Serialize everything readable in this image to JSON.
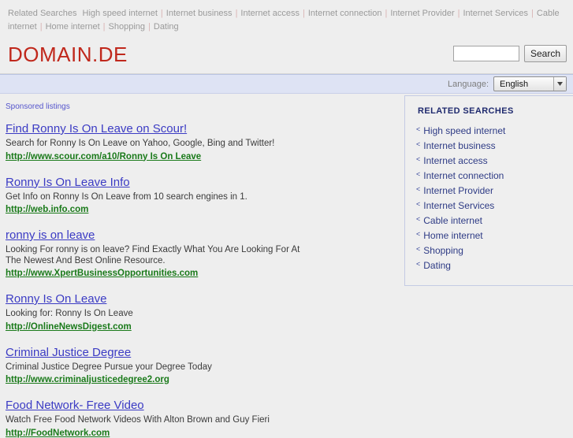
{
  "top_strip": {
    "label": "Related Searches",
    "links": [
      "High speed internet",
      "Internet business",
      "Internet access",
      "Internet connection",
      "Internet Provider",
      "Internet Services",
      "Cable internet",
      "Home internet",
      "Shopping",
      "Dating"
    ]
  },
  "header": {
    "logo": "DOMAIN.DE",
    "search_value": "",
    "search_placeholder": "",
    "search_button": "Search"
  },
  "language_bar": {
    "label": "Language:",
    "selected": "English",
    "arrow_icon": "chevron-down-icon"
  },
  "main": {
    "sponsored_label": "Sponsored listings",
    "ads": [
      {
        "title": "Find Ronny Is On Leave on Scour!",
        "desc": "Search for Ronny Is On Leave on Yahoo, Google, Bing and Twitter!",
        "url": "http://www.scour.com/a10/Ronny Is On Leave"
      },
      {
        "title": "Ronny Is On Leave Info",
        "desc": "Get Info on Ronny Is On Leave from 10 search engines in 1.",
        "url": "http://web.info.com"
      },
      {
        "title": "ronny is on leave",
        "desc": "Looking For ronny is on leave? Find Exactly What You Are Looking For At The Newest And Best Online Resource.",
        "url": "http://www.XpertBusinessOpportunities.com"
      },
      {
        "title": "Ronny Is On Leave",
        "desc": "Looking for: Ronny Is On Leave",
        "url": "http://OnlineNewsDigest.com"
      },
      {
        "title": "Criminal Justice Degree",
        "desc": "Criminal Justice Degree Pursue your Degree Today",
        "url": "http://www.criminaljusticedegree2.org"
      },
      {
        "title": "Food Network- Free Video",
        "desc": "Watch Free Food Network Videos With Alton Brown and Guy Fieri",
        "url": "http://FoodNetwork.com"
      }
    ]
  },
  "sidebar": {
    "title": "RELATED SEARCHES",
    "bullet": "˂",
    "items": [
      "High speed internet",
      "Internet business",
      "Internet access",
      "Internet connection",
      "Internet Provider",
      "Internet Services",
      "Cable internet",
      "Home internet",
      "Shopping",
      "Dating"
    ]
  },
  "colors": {
    "page_bg": "#eeeeee",
    "logo": "#c0281c",
    "language_bar": "#dee3f4",
    "ad_title": "#3b3bc4",
    "ad_url": "#1a7a1a",
    "sidebar_title": "#1f2a6e"
  }
}
